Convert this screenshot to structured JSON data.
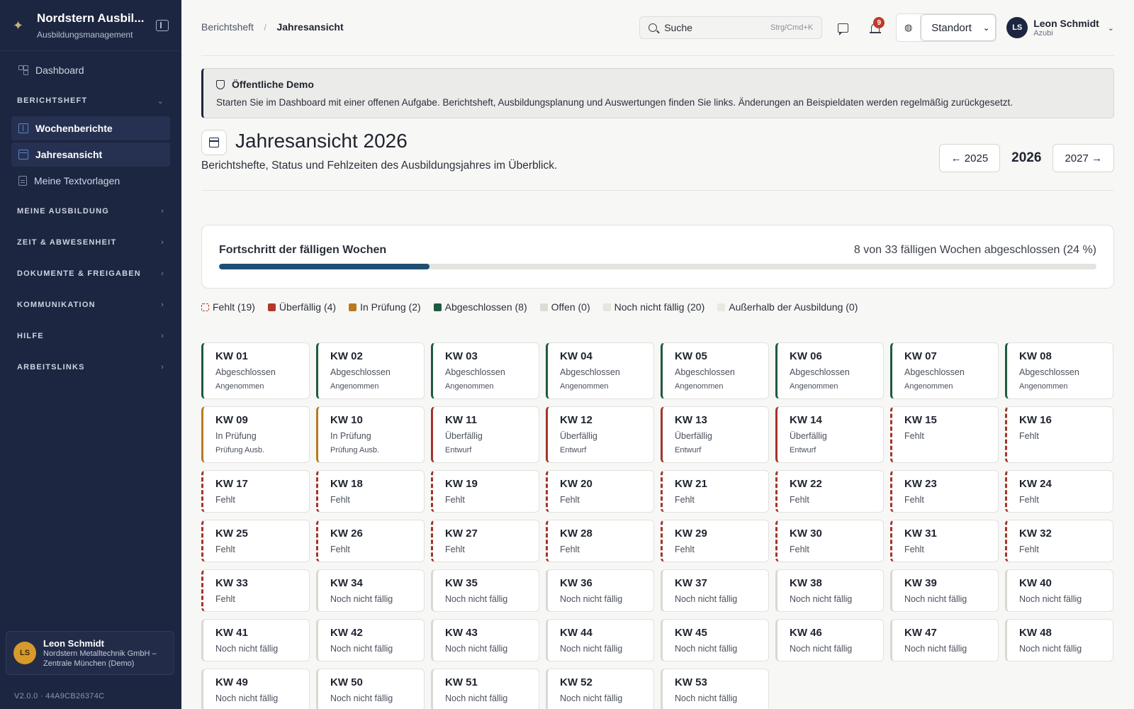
{
  "sidebar": {
    "brand_title": "Nordstern Ausbil...",
    "brand_sub": "Ausbildungsmanagement",
    "dashboard": "Dashboard",
    "section_berichtsheft": "BERICHTSHEFT",
    "items": [
      {
        "label": "Wochenberichte",
        "icon": "book-icon"
      },
      {
        "label": "Jahresansicht",
        "icon": "calendar-icon"
      },
      {
        "label": "Meine Textvorlagen",
        "icon": "document-icon"
      }
    ],
    "sections": [
      "MEINE AUSBILDUNG",
      "ZEIT & ABWESENHEIT",
      "DOKUMENTE & FREIGABEN",
      "KOMMUNIKATION",
      "HILFE",
      "ARBEITSLINKS"
    ],
    "footer": {
      "initials": "LS",
      "name": "Leon Schmidt",
      "org_line1": "Nordstern Metalltechnik GmbH –",
      "org_line2": "Zentrale München (Demo)"
    },
    "version": "V2.0.0 · 44A9CB26374C"
  },
  "topbar": {
    "breadcrumb_parent": "Berichtsheft",
    "breadcrumb_sep": "/",
    "breadcrumb_current": "Jahresansicht",
    "search_placeholder": "Suche",
    "search_shortcut": "Strg/Cmd+K",
    "notification_count": "9",
    "location_label": "Standort",
    "user_initials": "LS",
    "user_name": "Leon Schmidt",
    "user_role": "Azubi"
  },
  "demo": {
    "title": "Öffentliche Demo",
    "text": "Starten Sie im Dashboard mit einer offenen Aufgabe. Berichtsheft, Ausbildungsplanung und Auswertungen finden Sie links. Änderungen an Beispieldaten werden regelmäßig zurückgesetzt."
  },
  "header": {
    "title": "Jahresansicht 2026",
    "subtitle": "Berichtshefte, Status und Fehlzeiten des Ausbildungsjahres im Überblick.",
    "prev_year": "← 2025",
    "current_year": "2026",
    "next_year": "2027 →"
  },
  "progress": {
    "title": "Fortschritt der fälligen Wochen",
    "summary": "8 von 33 fälligen Wochen abgeschlossen (24 %)",
    "fraction": 0.24
  },
  "colors": {
    "abgeschlossen": "#1e5a3e",
    "pruefung": "#b87a1f",
    "ueberfaellig": "#a3342a",
    "offen": "#d8d8d4",
    "progress": "#1f4e72"
  },
  "legend": [
    {
      "label": "Fehlt (19)",
      "key": "fehlt",
      "color": "#b0392b"
    },
    {
      "label": "Überfällig (4)",
      "key": "ueberfaellig",
      "color": "#b0392b"
    },
    {
      "label": "In Prüfung (2)",
      "key": "pruefung",
      "color": "#b87a1f"
    },
    {
      "label": "Abgeschlossen (8)",
      "key": "abgeschlossen",
      "color": "#1e5a3e"
    },
    {
      "label": "Offen (0)",
      "key": "offen",
      "color": "#dcdbd6"
    },
    {
      "label": "Noch nicht fällig (20)",
      "key": "nicht",
      "color": "#e6e5e0"
    },
    {
      "label": "Außerhalb der Ausbildung (0)",
      "key": "ausserhalb",
      "color": "#e9e8e3"
    }
  ],
  "weeks": [
    {
      "kw": "KW 01",
      "status": "Abgeschlossen",
      "detail": "Angenommen",
      "type": "abgeschlossen"
    },
    {
      "kw": "KW 02",
      "status": "Abgeschlossen",
      "detail": "Angenommen",
      "type": "abgeschlossen"
    },
    {
      "kw": "KW 03",
      "status": "Abgeschlossen",
      "detail": "Angenommen",
      "type": "abgeschlossen"
    },
    {
      "kw": "KW 04",
      "status": "Abgeschlossen",
      "detail": "Angenommen",
      "type": "abgeschlossen"
    },
    {
      "kw": "KW 05",
      "status": "Abgeschlossen",
      "detail": "Angenommen",
      "type": "abgeschlossen"
    },
    {
      "kw": "KW 06",
      "status": "Abgeschlossen",
      "detail": "Angenommen",
      "type": "abgeschlossen"
    },
    {
      "kw": "KW 07",
      "status": "Abgeschlossen",
      "detail": "Angenommen",
      "type": "abgeschlossen"
    },
    {
      "kw": "KW 08",
      "status": "Abgeschlossen",
      "detail": "Angenommen",
      "type": "abgeschlossen"
    },
    {
      "kw": "KW 09",
      "status": "In Prüfung",
      "detail": "Prüfung Ausb.",
      "type": "pruefung"
    },
    {
      "kw": "KW 10",
      "status": "In Prüfung",
      "detail": "Prüfung Ausb.",
      "type": "pruefung"
    },
    {
      "kw": "KW 11",
      "status": "Überfällig",
      "detail": "Entwurf",
      "type": "ueberfaellig"
    },
    {
      "kw": "KW 12",
      "status": "Überfällig",
      "detail": "Entwurf",
      "type": "ueberfaellig"
    },
    {
      "kw": "KW 13",
      "status": "Überfällig",
      "detail": "Entwurf",
      "type": "ueberfaellig"
    },
    {
      "kw": "KW 14",
      "status": "Überfällig",
      "detail": "Entwurf",
      "type": "ueberfaellig"
    },
    {
      "kw": "KW 15",
      "status": "Fehlt",
      "detail": "",
      "type": "fehlt"
    },
    {
      "kw": "KW 16",
      "status": "Fehlt",
      "detail": "",
      "type": "fehlt"
    },
    {
      "kw": "KW 17",
      "status": "Fehlt",
      "detail": "",
      "type": "fehlt"
    },
    {
      "kw": "KW 18",
      "status": "Fehlt",
      "detail": "",
      "type": "fehlt"
    },
    {
      "kw": "KW 19",
      "status": "Fehlt",
      "detail": "",
      "type": "fehlt"
    },
    {
      "kw": "KW 20",
      "status": "Fehlt",
      "detail": "",
      "type": "fehlt"
    },
    {
      "kw": "KW 21",
      "status": "Fehlt",
      "detail": "",
      "type": "fehlt"
    },
    {
      "kw": "KW 22",
      "status": "Fehlt",
      "detail": "",
      "type": "fehlt"
    },
    {
      "kw": "KW 23",
      "status": "Fehlt",
      "detail": "",
      "type": "fehlt"
    },
    {
      "kw": "KW 24",
      "status": "Fehlt",
      "detail": "",
      "type": "fehlt"
    },
    {
      "kw": "KW 25",
      "status": "Fehlt",
      "detail": "",
      "type": "fehlt"
    },
    {
      "kw": "KW 26",
      "status": "Fehlt",
      "detail": "",
      "type": "fehlt"
    },
    {
      "kw": "KW 27",
      "status": "Fehlt",
      "detail": "",
      "type": "fehlt"
    },
    {
      "kw": "KW 28",
      "status": "Fehlt",
      "detail": "",
      "type": "fehlt"
    },
    {
      "kw": "KW 29",
      "status": "Fehlt",
      "detail": "",
      "type": "fehlt"
    },
    {
      "kw": "KW 30",
      "status": "Fehlt",
      "detail": "",
      "type": "fehlt"
    },
    {
      "kw": "KW 31",
      "status": "Fehlt",
      "detail": "",
      "type": "fehlt"
    },
    {
      "kw": "KW 32",
      "status": "Fehlt",
      "detail": "",
      "type": "fehlt"
    },
    {
      "kw": "KW 33",
      "status": "Fehlt",
      "detail": "",
      "type": "fehlt"
    },
    {
      "kw": "KW 34",
      "status": "Noch nicht fällig",
      "detail": "",
      "type": "nicht"
    },
    {
      "kw": "KW 35",
      "status": "Noch nicht fällig",
      "detail": "",
      "type": "nicht"
    },
    {
      "kw": "KW 36",
      "status": "Noch nicht fällig",
      "detail": "",
      "type": "nicht"
    },
    {
      "kw": "KW 37",
      "status": "Noch nicht fällig",
      "detail": "",
      "type": "nicht"
    },
    {
      "kw": "KW 38",
      "status": "Noch nicht fällig",
      "detail": "",
      "type": "nicht"
    },
    {
      "kw": "KW 39",
      "status": "Noch nicht fällig",
      "detail": "",
      "type": "nicht"
    },
    {
      "kw": "KW 40",
      "status": "Noch nicht fällig",
      "detail": "",
      "type": "nicht"
    },
    {
      "kw": "KW 41",
      "status": "Noch nicht fällig",
      "detail": "",
      "type": "nicht"
    },
    {
      "kw": "KW 42",
      "status": "Noch nicht fällig",
      "detail": "",
      "type": "nicht"
    },
    {
      "kw": "KW 43",
      "status": "Noch nicht fällig",
      "detail": "",
      "type": "nicht"
    },
    {
      "kw": "KW 44",
      "status": "Noch nicht fällig",
      "detail": "",
      "type": "nicht"
    },
    {
      "kw": "KW 45",
      "status": "Noch nicht fällig",
      "detail": "",
      "type": "nicht"
    },
    {
      "kw": "KW 46",
      "status": "Noch nicht fällig",
      "detail": "",
      "type": "nicht"
    },
    {
      "kw": "KW 47",
      "status": "Noch nicht fällig",
      "detail": "",
      "type": "nicht"
    },
    {
      "kw": "KW 48",
      "status": "Noch nicht fällig",
      "detail": "",
      "type": "nicht"
    },
    {
      "kw": "KW 49",
      "status": "Noch nicht fällig",
      "detail": "",
      "type": "nicht"
    },
    {
      "kw": "KW 50",
      "status": "Noch nicht fällig",
      "detail": "",
      "type": "nicht"
    },
    {
      "kw": "KW 51",
      "status": "Noch nicht fällig",
      "detail": "",
      "type": "nicht"
    },
    {
      "kw": "KW 52",
      "status": "Noch nicht fällig",
      "detail": "",
      "type": "nicht"
    },
    {
      "kw": "KW 53",
      "status": "Noch nicht fällig",
      "detail": "",
      "type": "nicht"
    }
  ]
}
